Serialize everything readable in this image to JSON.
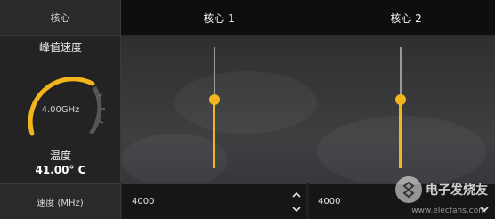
{
  "header": {
    "left_label": "核心",
    "cores": [
      "核心 1",
      "核心 2"
    ]
  },
  "left_panel": {
    "peak_label": "峰值速度",
    "gauge_value": "4.00GHz",
    "gauge_level_percent": 75,
    "temp_label": "温度",
    "temp_value": "41.00° C"
  },
  "sliders": [
    {
      "core": "核心 1",
      "level_fraction": 0.55
    },
    {
      "core": "核心 2",
      "level_fraction": 0.55
    }
  ],
  "bottom": {
    "speed_label": "速度 (MHz)",
    "core1_value": "4000",
    "core2_value": "4000"
  },
  "watermark": {
    "text": "电子发烧友",
    "sub": "www.elecfans.com"
  },
  "colors": {
    "accent": "#f2b51e",
    "track": "#9a9a9a",
    "background": "#1f1f1f"
  },
  "icons": [
    "spin-up-icon",
    "spin-down-icon",
    "watermark-logo-icon"
  ]
}
